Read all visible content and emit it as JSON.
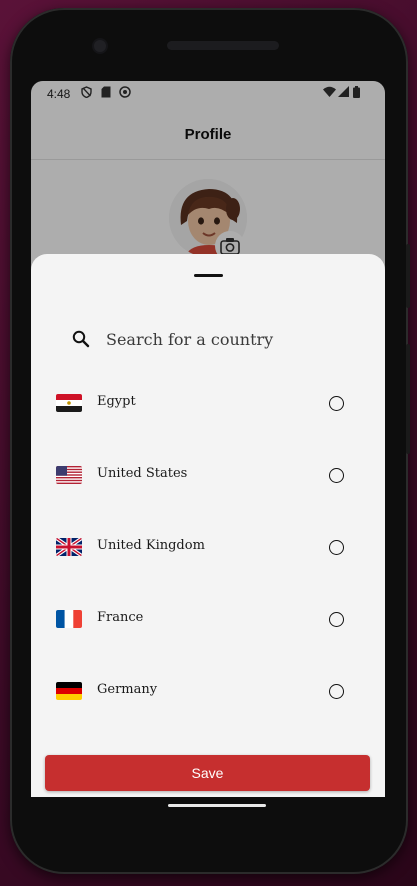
{
  "status_bar": {
    "time": "4:48",
    "left_icons": [
      "shield-icon",
      "sd-card-icon",
      "sync-icon"
    ],
    "right_icons": [
      "wifi-icon",
      "signal-icon",
      "battery-icon"
    ]
  },
  "app_bar": {
    "title": "Profile"
  },
  "sheet": {
    "search": {
      "placeholder": "Search for a country",
      "value": ""
    },
    "countries": [
      {
        "name": "Egypt",
        "flag": "egypt-flag-icon",
        "selected": false
      },
      {
        "name": "United States",
        "flag": "us-flag-icon",
        "selected": false
      },
      {
        "name": "United Kingdom",
        "flag": "uk-flag-icon",
        "selected": false
      },
      {
        "name": "France",
        "flag": "france-flag-icon",
        "selected": false
      },
      {
        "name": "Germany",
        "flag": "germany-flag-icon",
        "selected": false
      }
    ],
    "save_label": "Save"
  },
  "colors": {
    "accent": "#c62f2f",
    "sheet_background": "#f4f4f4",
    "scrim": "rgba(0,0,0,0.32)"
  }
}
